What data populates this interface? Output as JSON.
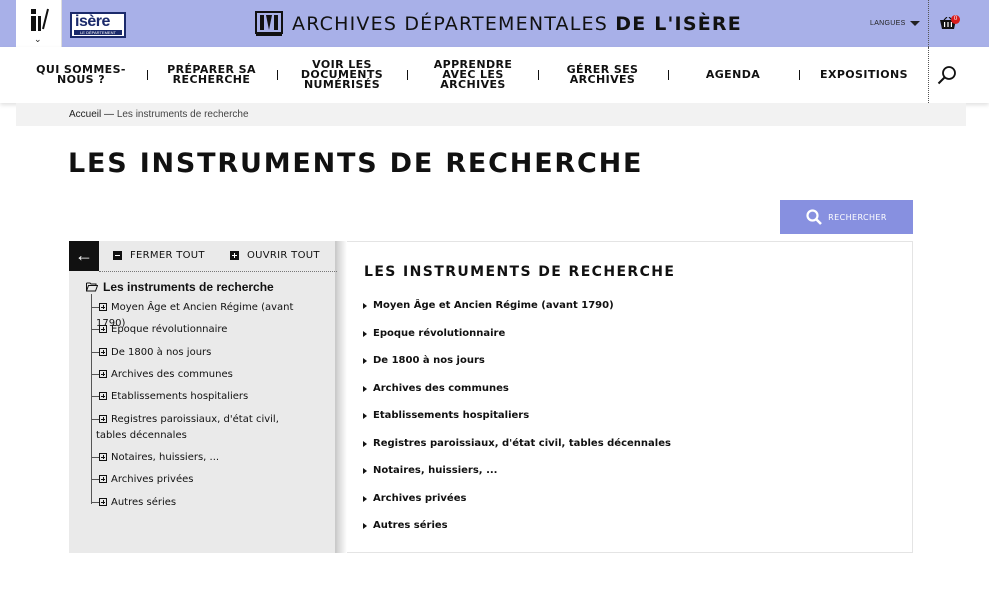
{
  "header": {
    "logo_text": "isère",
    "logo_subtext": "LE DÉPARTEMENT",
    "title_regular": "ARCHIVES DÉPARTEMENTALES",
    "title_bold": "DE L'ISÈRE",
    "langues_label": "LANGUES",
    "cart_count": "0",
    "accent_color": "#a8b0e8"
  },
  "nav": {
    "items": [
      {
        "label": "QUI SOMMES-NOUS ?"
      },
      {
        "label": "PRÉPARER SA RECHERCHE"
      },
      {
        "label": "VOIR LES DOCUMENTS NUMÉRISÉS"
      },
      {
        "label": "APPRENDRE AVEC LES ARCHIVES"
      },
      {
        "label": "GÉRER SES ARCHIVES"
      },
      {
        "label": "AGENDA"
      },
      {
        "label": "EXPOSITIONS"
      }
    ]
  },
  "breadcrumb": {
    "home": "Accueil",
    "separator": "—",
    "current": "Les instruments de recherche"
  },
  "page_title": "LES INSTRUMENTS DE RECHERCHE",
  "search_button": {
    "label": "RECHERCHER",
    "color": "#8790e0"
  },
  "tree": {
    "close_all": "FERMER TOUT",
    "open_all": "OUVRIR TOUT",
    "root": "Les instruments de recherche",
    "nodes": [
      "Moyen Âge et Ancien Régime (avant 1790)",
      "Epoque révolutionnaire",
      "De 1800 à nos jours",
      "Archives des communes",
      "Etablissements hospitaliers",
      "Registres paroissiaux, d'état civil, tables décennales",
      "Notaires, huissiers, ...",
      "Archives privées",
      "Autres séries"
    ]
  },
  "content": {
    "title": "LES INSTRUMENTS DE RECHERCHE",
    "items": [
      "Moyen Âge et Ancien Régime (avant 1790)",
      "Epoque révolutionnaire",
      "De 1800 à nos jours",
      "Archives des communes",
      "Etablissements hospitaliers",
      "Registres paroissiaux, d'état civil, tables décennales",
      "Notaires, huissiers, ...",
      "Archives privées",
      "Autres séries"
    ]
  }
}
